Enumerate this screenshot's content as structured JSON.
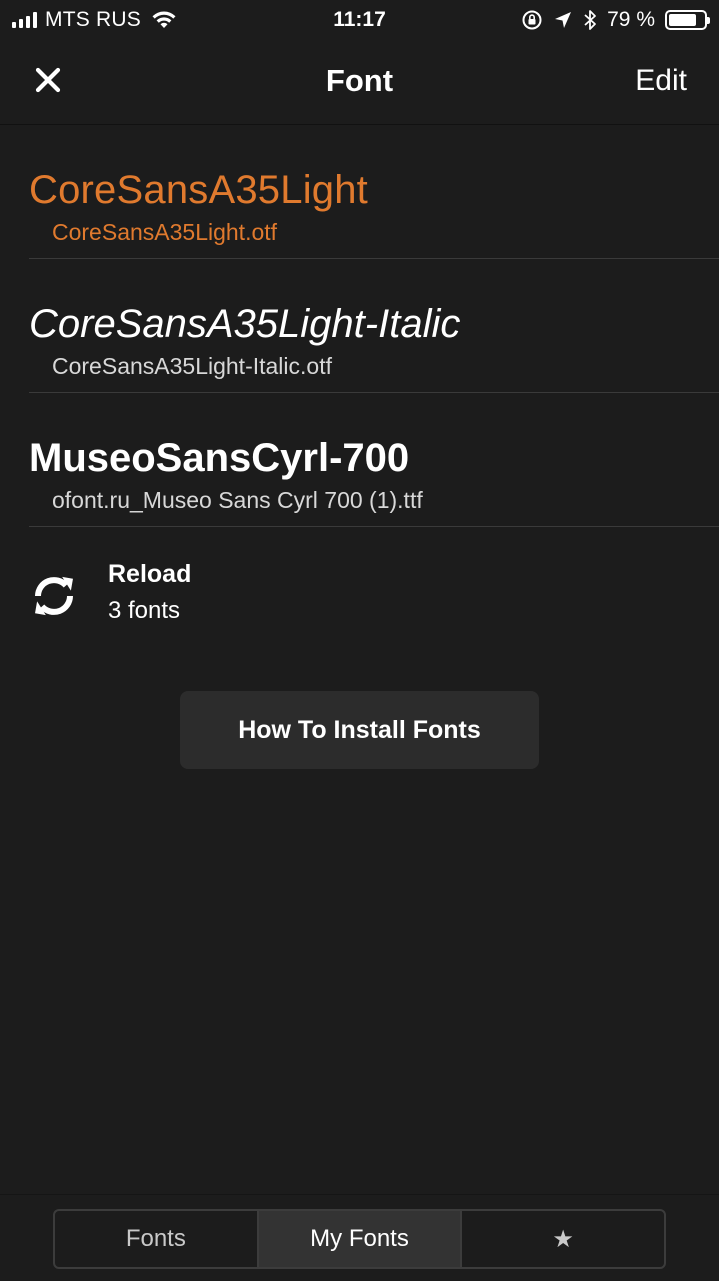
{
  "status_bar": {
    "carrier": "MTS RUS",
    "time": "11:17",
    "battery_percent": "79 %",
    "battery_level": 0.79,
    "icons": [
      "signal-icon",
      "wifi-icon",
      "rotation-lock-icon",
      "location-icon",
      "bluetooth-icon",
      "battery-icon"
    ]
  },
  "nav": {
    "title": "Font",
    "edit_label": "Edit",
    "close_icon": "close-icon"
  },
  "fonts": [
    {
      "name": "CoreSansA35Light",
      "file": "CoreSansA35Light.otf",
      "selected": true
    },
    {
      "name": "CoreSansA35Light-Italic",
      "file": "CoreSansA35Light-Italic.otf",
      "selected": false
    },
    {
      "name": "MuseoSansCyrl-700",
      "file": "ofont.ru_Museo Sans Cyrl 700 (1).ttf",
      "selected": false
    }
  ],
  "reload": {
    "title": "Reload",
    "count": "3 fonts",
    "icon": "reload-icon"
  },
  "how_to_install": {
    "label": "How To Install Fonts"
  },
  "tabs": [
    {
      "label": "Fonts",
      "selected": false
    },
    {
      "label": "My Fonts",
      "selected": true
    },
    {
      "label": "★",
      "selected": false
    }
  ],
  "colors": {
    "background": "#1c1c1c",
    "accent": "#e07a2e",
    "divider": "#3a3a3a",
    "button_bg": "#2c2c2c"
  }
}
